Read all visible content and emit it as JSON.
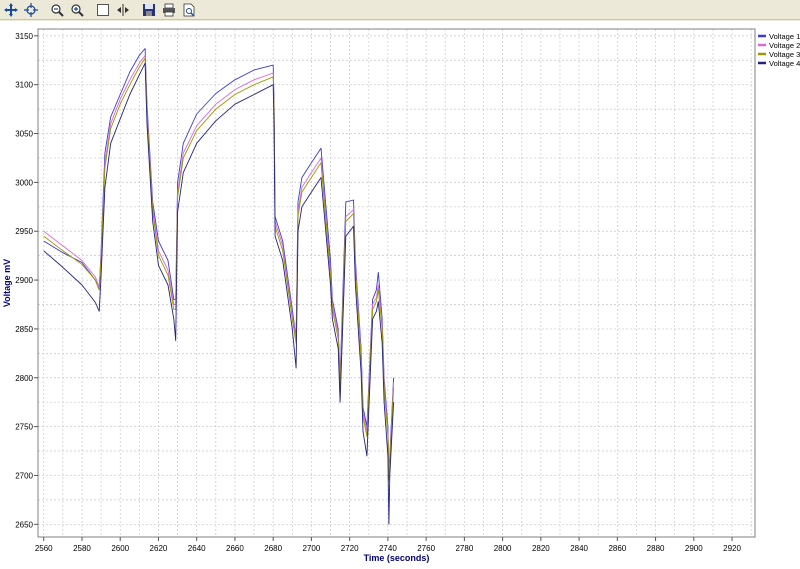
{
  "toolbar": {
    "buttons": [
      {
        "name": "pan-tool-button",
        "icon": "move-arrows-icon"
      },
      {
        "name": "select-point-tool-button",
        "icon": "crosshair-icon"
      },
      {
        "name": "zoom-out-button",
        "icon": "zoom-out-icon"
      },
      {
        "name": "zoom-in-button",
        "icon": "zoom-in-icon"
      },
      {
        "name": "zoom-box-button",
        "icon": "rectangle-icon"
      },
      {
        "name": "fit-horizontal-button",
        "icon": "fit-width-icon"
      },
      {
        "name": "save-button",
        "icon": "floppy-disk-icon"
      },
      {
        "name": "print-button",
        "icon": "printer-icon"
      },
      {
        "name": "print-preview-button",
        "icon": "print-preview-icon"
      }
    ]
  },
  "colors": {
    "grid": "#c8c8c8",
    "plot_bg": "#ffffff",
    "axis_title": "#00007a"
  },
  "chart_data": {
    "type": "line",
    "title": "",
    "xlabel": "Time (seconds)",
    "ylabel": "Voltage mV",
    "xlim": [
      2557,
      2932
    ],
    "ylim": [
      2637,
      3157
    ],
    "xticks": [
      2560,
      2580,
      2600,
      2620,
      2640,
      2660,
      2680,
      2700,
      2720,
      2740,
      2760,
      2780,
      2800,
      2820,
      2840,
      2860,
      2880,
      2900,
      2920
    ],
    "yticks": [
      2650,
      2700,
      2750,
      2800,
      2850,
      2900,
      2950,
      3000,
      3050,
      3100,
      3150
    ],
    "grid": true,
    "legend_position": "top-right",
    "series": [
      {
        "name": "Voltage 1",
        "color": "#3a3ad6",
        "x": [
          2560,
          2570,
          2580,
          2587,
          2589,
          2590,
          2592,
          2595,
          2600,
          2605,
          2610,
          2613,
          2614,
          2617,
          2620,
          2625,
          2628,
          2629,
          2630,
          2633,
          2640,
          2650,
          2660,
          2670,
          2680,
          2680.5,
          2681,
          2685,
          2690,
          2692,
          2693,
          2695,
          2700,
          2705,
          2710,
          2711,
          2714,
          2715,
          2718,
          2722,
          2723,
          2726,
          2727,
          2729,
          2732,
          2734,
          2735,
          2737,
          2738,
          2740,
          2740.5,
          2741,
          2743
        ],
        "y": [
          2940,
          2928,
          2918,
          2900,
          2890,
          2930,
          3030,
          3067,
          3090,
          3113,
          3130,
          3137,
          3080,
          2980,
          2940,
          2920,
          2880,
          2880,
          3000,
          3040,
          3070,
          3091,
          3105,
          3115,
          3120,
          3080,
          2965,
          2940,
          2870,
          2840,
          2980,
          3005,
          3020,
          3035,
          2920,
          2880,
          2850,
          2800,
          2980,
          2982,
          2920,
          2830,
          2770,
          2750,
          2880,
          2890,
          2908,
          2860,
          2800,
          2750,
          2700,
          2720,
          2800
        ]
      },
      {
        "name": "Voltage 2",
        "color": "#e066d8",
        "x": [
          2560,
          2570,
          2580,
          2587,
          2589,
          2590,
          2592,
          2595,
          2600,
          2605,
          2610,
          2613,
          2614,
          2617,
          2620,
          2625,
          2628,
          2629,
          2630,
          2633,
          2640,
          2650,
          2660,
          2670,
          2680,
          2680.5,
          2681,
          2685,
          2690,
          2692,
          2693,
          2695,
          2700,
          2705,
          2710,
          2711,
          2714,
          2715,
          2718,
          2722,
          2723,
          2726,
          2727,
          2729,
          2732,
          2734,
          2735,
          2737,
          2738,
          2740,
          2740.5,
          2741,
          2743
        ],
        "y": [
          2950,
          2935,
          2920,
          2903,
          2893,
          2925,
          3020,
          3060,
          3085,
          3105,
          3122,
          3130,
          3075,
          2975,
          2930,
          2910,
          2875,
          2875,
          2990,
          3030,
          3058,
          3080,
          3095,
          3105,
          3112,
          3075,
          2960,
          2935,
          2865,
          2838,
          2970,
          2995,
          3010,
          3025,
          2910,
          2875,
          2845,
          2795,
          2965,
          2972,
          2915,
          2825,
          2765,
          2745,
          2875,
          2882,
          2895,
          2855,
          2795,
          2745,
          2700,
          2715,
          2795
        ]
      },
      {
        "name": "Voltage 3",
        "color": "#9a9a00",
        "x": [
          2560,
          2570,
          2580,
          2587,
          2589,
          2590,
          2592,
          2595,
          2600,
          2605,
          2610,
          2613,
          2614,
          2617,
          2620,
          2625,
          2628,
          2629,
          2630,
          2633,
          2640,
          2650,
          2660,
          2670,
          2680,
          2680.5,
          2681,
          2685,
          2690,
          2692,
          2693,
          2695,
          2700,
          2705,
          2710,
          2711,
          2714,
          2715,
          2718,
          2722,
          2723,
          2726,
          2727,
          2729,
          2732,
          2734,
          2735,
          2737,
          2738,
          2740,
          2740.5,
          2741,
          2743
        ],
        "y": [
          2945,
          2930,
          2916,
          2900,
          2890,
          2920,
          3015,
          3055,
          3080,
          3100,
          3118,
          3127,
          3070,
          2970,
          2925,
          2905,
          2870,
          2870,
          2985,
          3025,
          3053,
          3075,
          3090,
          3100,
          3108,
          3070,
          2955,
          2930,
          2860,
          2835,
          2965,
          2990,
          3005,
          3020,
          2905,
          2870,
          2840,
          2790,
          2960,
          2968,
          2910,
          2820,
          2760,
          2740,
          2870,
          2878,
          2890,
          2850,
          2790,
          2740,
          2695,
          2712,
          2790
        ]
      },
      {
        "name": "Voltage 4",
        "color": "#232380",
        "x": [
          2560,
          2570,
          2580,
          2587,
          2589,
          2590,
          2592,
          2595,
          2600,
          2605,
          2610,
          2613,
          2614,
          2617,
          2620,
          2625,
          2628,
          2629,
          2630,
          2633,
          2640,
          2650,
          2660,
          2670,
          2680,
          2680.5,
          2681,
          2685,
          2690,
          2692,
          2693,
          2695,
          2700,
          2705,
          2710,
          2711,
          2714,
          2715,
          2718,
          2722,
          2723,
          2726,
          2727,
          2729,
          2732,
          2734,
          2735,
          2737,
          2738,
          2740,
          2740.5,
          2741,
          2743
        ],
        "y": [
          2930,
          2913,
          2895,
          2877,
          2868,
          2905,
          2995,
          3040,
          3065,
          3090,
          3110,
          3122,
          3060,
          2960,
          2915,
          2895,
          2860,
          2838,
          2970,
          3010,
          3040,
          3063,
          3080,
          3090,
          3100,
          3055,
          2945,
          2920,
          2850,
          2810,
          2950,
          2975,
          2990,
          3005,
          2895,
          2860,
          2830,
          2775,
          2945,
          2955,
          2895,
          2805,
          2745,
          2720,
          2860,
          2868,
          2878,
          2835,
          2775,
          2720,
          2650,
          2700,
          2775
        ]
      }
    ]
  }
}
